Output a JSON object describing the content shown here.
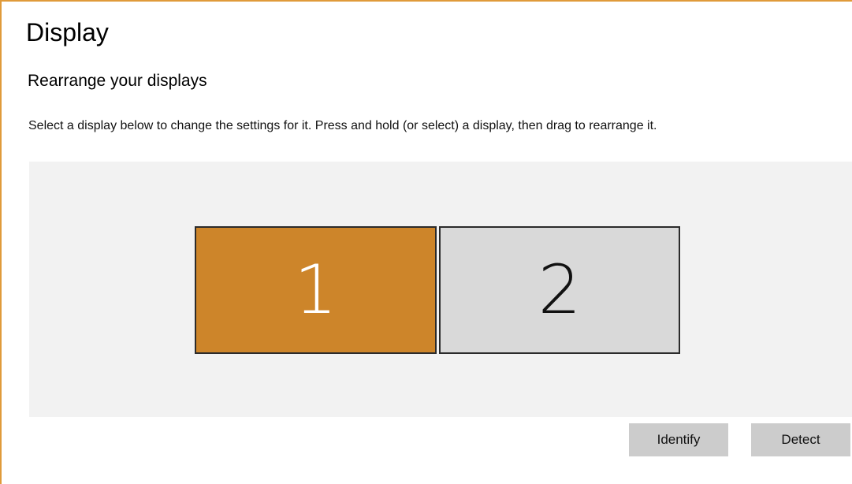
{
  "page": {
    "title": "Display",
    "section_title": "Rearrange your displays",
    "instructions": "Select a display below to change the settings for it. Press and hold (or select) a display, then drag to rearrange it."
  },
  "displays": [
    {
      "label": "1",
      "selected": true,
      "color": "#cd852a"
    },
    {
      "label": "2",
      "selected": false,
      "color": "#d9d9d9"
    }
  ],
  "buttons": {
    "identify_label": "Identify",
    "detect_label": "Detect"
  },
  "colors": {
    "accent": "#e09a3a",
    "arrange_background": "#f2f2f2",
    "button_background": "#cccccc"
  }
}
